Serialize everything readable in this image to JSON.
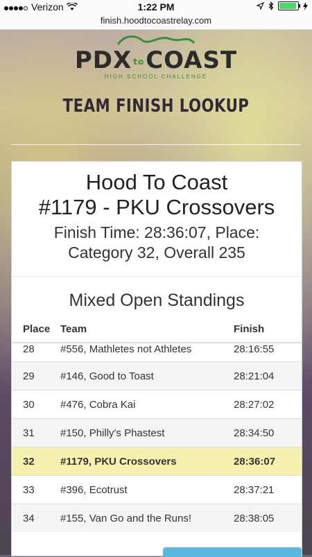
{
  "status_bar": {
    "carrier": "Verizon",
    "time": "1:22 PM",
    "battery_level": 0.85,
    "icons": [
      "signal-dots-icon",
      "wifi-icon",
      "location-arrow-icon",
      "bluetooth-icon",
      "battery-icon",
      "charging-icon"
    ]
  },
  "browser": {
    "url": "finish.hoodtocoastrelay.com"
  },
  "logo": {
    "main_left": "PDX",
    "main_to": "to",
    "main_right": "COAST",
    "subtitle": "HIGH SCHOOL CHALLENGE"
  },
  "page_title": "TEAM FINISH LOOKUP",
  "result": {
    "race": "Hood To Coast",
    "team": "#1179 - PKU Crossovers",
    "finish_line1": "Finish Time: 28:36:07, Place:",
    "finish_line2": "Category 32, Overall 235"
  },
  "standings": {
    "title": "Mixed Open Standings",
    "columns": {
      "place": "Place",
      "team": "Team",
      "finish": "Finish"
    },
    "rows": [
      {
        "place": "28",
        "team": "#556, Mathletes not Athletes",
        "finish": "28:16:55"
      },
      {
        "place": "29",
        "team": "#146, Good to Toast",
        "finish": "28:21:04"
      },
      {
        "place": "30",
        "team": "#476, Cobra Kai",
        "finish": "28:27:02"
      },
      {
        "place": "31",
        "team": "#150, Philly's Phastest",
        "finish": "28:34:50"
      },
      {
        "place": "32",
        "team": "#1179, PKU Crossovers",
        "finish": "28:36:07"
      },
      {
        "place": "33",
        "team": "#396, Ecotrust",
        "finish": "28:37:21"
      },
      {
        "place": "34",
        "team": "#155, Van Go and the Runs!",
        "finish": "28:38:05"
      }
    ]
  },
  "colors": {
    "highlight": "#f7f1b0",
    "accent_green": "#3a8d3a",
    "button_blue": "#5ab8de"
  }
}
